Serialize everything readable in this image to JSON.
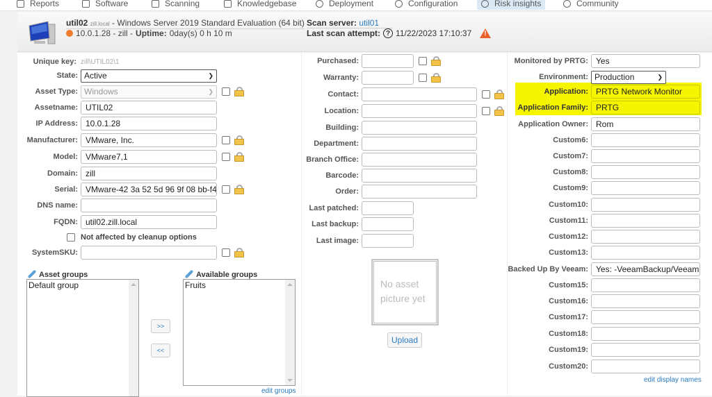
{
  "nav": {
    "items": [
      {
        "label": "Reports",
        "icon": "report-icon"
      },
      {
        "label": "Software",
        "icon": "grid-icon"
      },
      {
        "label": "Scanning",
        "icon": "scan-icon"
      },
      {
        "label": "Knowledgebase",
        "icon": "book-icon"
      },
      {
        "label": "Deployment",
        "icon": "box-icon"
      },
      {
        "label": "Configuration",
        "icon": "config-icon"
      },
      {
        "label": "Risk insights",
        "icon": "shield-icon",
        "active": true
      },
      {
        "label": "Community",
        "icon": "community-icon"
      }
    ]
  },
  "header": {
    "hostname": "util02",
    "domain_suffix": "zill.local",
    "os_text": " - Windows Server 2019 Standard Evaluation (64 bit)",
    "status_color": "#f07a2e",
    "ip_domain": "10.0.1.28 - zill - ",
    "uptime_label": "Uptime:",
    "uptime_value": "0day(s) 0 h 10 m",
    "scan_server_label": "Scan server:",
    "scan_server_value": "util01",
    "last_scan_label": "Last scan attempt:",
    "last_scan_value": "11/22/2023 17:10:37"
  },
  "left": {
    "unique_key_label": "Unique key:",
    "unique_key_value": "zill\\UTIL02\\1",
    "state_label": "State:",
    "state_value": "Active",
    "asset_type_label": "Asset Type:",
    "asset_type_value": "Windows",
    "assetname_label": "Assetname:",
    "assetname_value": "UTIL02",
    "ip_label": "IP Address:",
    "ip_value": "10.0.1.28",
    "manufacturer_label": "Manufacturer:",
    "manufacturer_value": "VMware, Inc.",
    "model_label": "Model:",
    "model_value": "VMware7,1",
    "domain_label": "Domain:",
    "domain_value": "zill",
    "serial_label": "Serial:",
    "serial_value": "VMware-42 3a 52 5d 96 9f 08 bb-f4",
    "dns_label": "DNS name:",
    "dns_value": "",
    "fqdn_label": "FQDN:",
    "fqdn_value": "util02.zill.local",
    "cleanup_label": "Not affected by cleanup options",
    "sku_label": "SystemSKU:",
    "sku_value": ""
  },
  "groups": {
    "asset_groups_label": "Asset groups",
    "asset_groups": [
      "Default group"
    ],
    "available_groups_label": "Available groups",
    "available_groups": [
      "Fruits"
    ],
    "add_button": ">>",
    "remove_button": "<<",
    "edit_groups_link": "edit groups"
  },
  "middle": {
    "purchased_label": "Purchased:",
    "warranty_label": "Warranty:",
    "contact_label": "Contact:",
    "location_label": "Location:",
    "building_label": "Building:",
    "department_label": "Department:",
    "branch_label": "Branch Office:",
    "barcode_label": "Barcode:",
    "order_label": "Order:",
    "last_patched_label": "Last patched:",
    "last_backup_label": "Last backup:",
    "last_image_label": "Last image:",
    "picture_placeholder": "No asset picture yet",
    "upload_button": "Upload"
  },
  "right": {
    "highlight_color": "#f5f500",
    "fields": [
      {
        "label": "Monitored by PRTG:",
        "value": "Yes"
      },
      {
        "label": "Environment:",
        "value": "Production",
        "type": "select"
      },
      {
        "label": "Application:",
        "value": "PRTG Network Monitor",
        "highlight": true
      },
      {
        "label": "Application Family:",
        "value": "PRTG",
        "highlight": true
      },
      {
        "label": "Application Owner:",
        "value": "Rom"
      },
      {
        "label": "Custom6:",
        "value": ""
      },
      {
        "label": "Custom7:",
        "value": ""
      },
      {
        "label": "Custom8:",
        "value": ""
      },
      {
        "label": "Custom9:",
        "value": ""
      },
      {
        "label": "Custom10:",
        "value": ""
      },
      {
        "label": "Custom11:",
        "value": ""
      },
      {
        "label": "Custom12:",
        "value": ""
      },
      {
        "label": "Custom13:",
        "value": ""
      },
      {
        "label": "Backed Up By Veeam:",
        "value": "Yes: -VeeamBackup/Veeam"
      },
      {
        "label": "Custom15:",
        "value": ""
      },
      {
        "label": "Custom16:",
        "value": ""
      },
      {
        "label": "Custom17:",
        "value": ""
      },
      {
        "label": "Custom18:",
        "value": ""
      },
      {
        "label": "Custom19:",
        "value": ""
      },
      {
        "label": "Custom20:",
        "value": ""
      }
    ],
    "edit_names_link": "edit display names"
  }
}
